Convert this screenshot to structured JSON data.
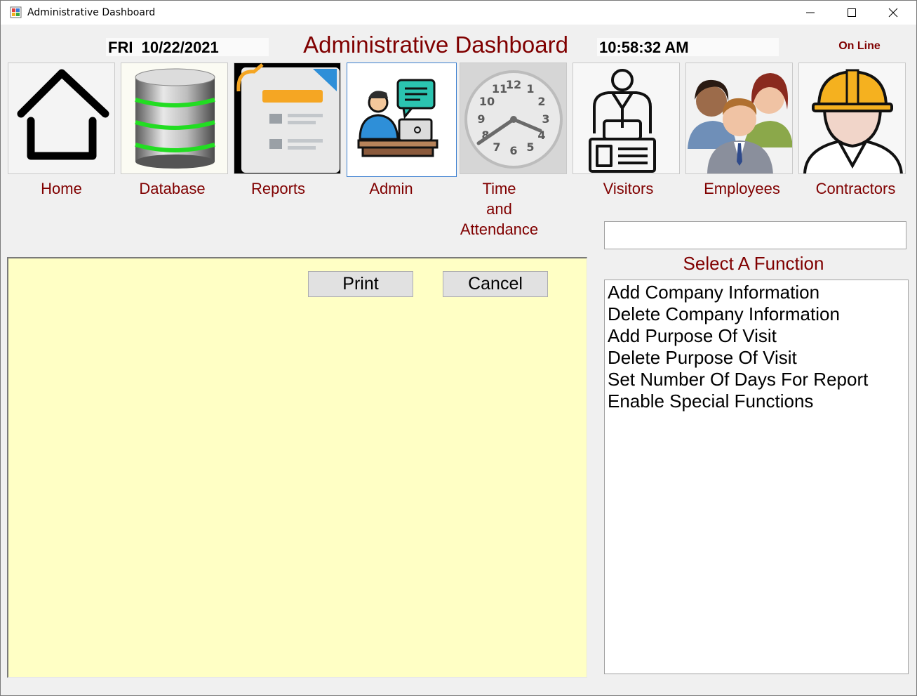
{
  "window": {
    "title": "Administrative Dashboard"
  },
  "header": {
    "date": "FRI  10/22/2021",
    "title": "Administrative Dashboard",
    "time": "10:58:32 AM",
    "status": "On Line",
    "title_color": "#800000"
  },
  "nav": [
    {
      "label": "Home",
      "icon": "home-icon"
    },
    {
      "label": "Database",
      "icon": "database-icon"
    },
    {
      "label": "Reports",
      "icon": "reports-icon"
    },
    {
      "label": "Admin",
      "icon": "admin-icon",
      "selected": true
    },
    {
      "label": "Time and Attendance",
      "icon": "clock-icon"
    },
    {
      "label": "Visitors",
      "icon": "visitor-icon"
    },
    {
      "label": "Employees",
      "icon": "employees-icon"
    },
    {
      "label": "Contractors",
      "icon": "contractor-icon"
    }
  ],
  "time_label_lines": [
    "Time",
    "and",
    "Attendance"
  ],
  "search": {
    "value": ""
  },
  "functions": {
    "title": "Select A Function",
    "items": [
      "Add Company Information",
      "Delete Company Information",
      "Add Purpose Of Visit",
      "Delete Purpose Of Visit",
      "Set Number Of Days For Report",
      "Enable Special Functions"
    ]
  },
  "panel": {
    "print_label": "Print",
    "cancel_label": "Cancel",
    "background": "#ffffc5"
  }
}
